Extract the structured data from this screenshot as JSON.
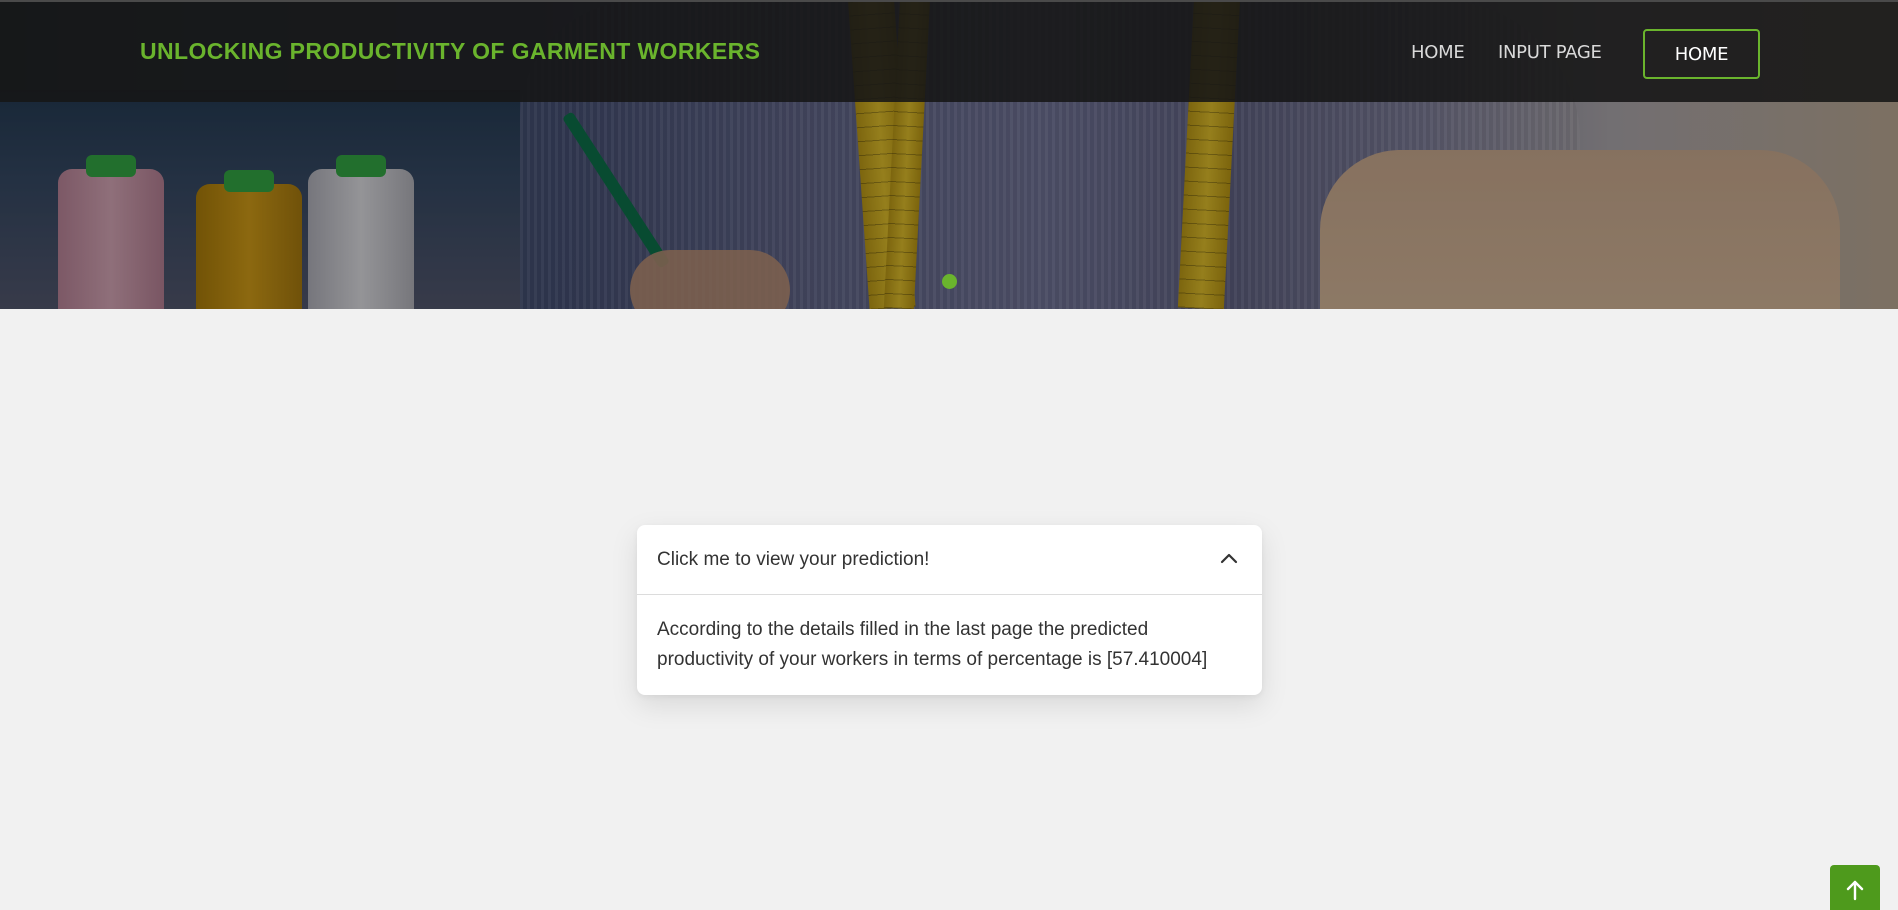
{
  "navbar": {
    "brand": "UNLOCKING PRODUCTIVITY OF GARMENT WORKERS",
    "links": [
      {
        "label": "HOME"
      },
      {
        "label": "INPUT PAGE"
      }
    ],
    "button_label": "HOME"
  },
  "hero": {
    "carousel_active_index": 0,
    "carousel_count": 1
  },
  "accordion": {
    "header": "Click me to view your prediction!",
    "expanded": true,
    "body": "According to the details filled in the last page the predicted productivity of your workers in terms of percentage is [57.410004]"
  },
  "icons": {
    "accordion_toggle": "chevron-up-icon",
    "back_to_top": "arrow-up-icon"
  },
  "colors": {
    "accent": "#6ab42d",
    "page_background": "#f1f1f1",
    "back_to_top": "#4e9a1c"
  }
}
